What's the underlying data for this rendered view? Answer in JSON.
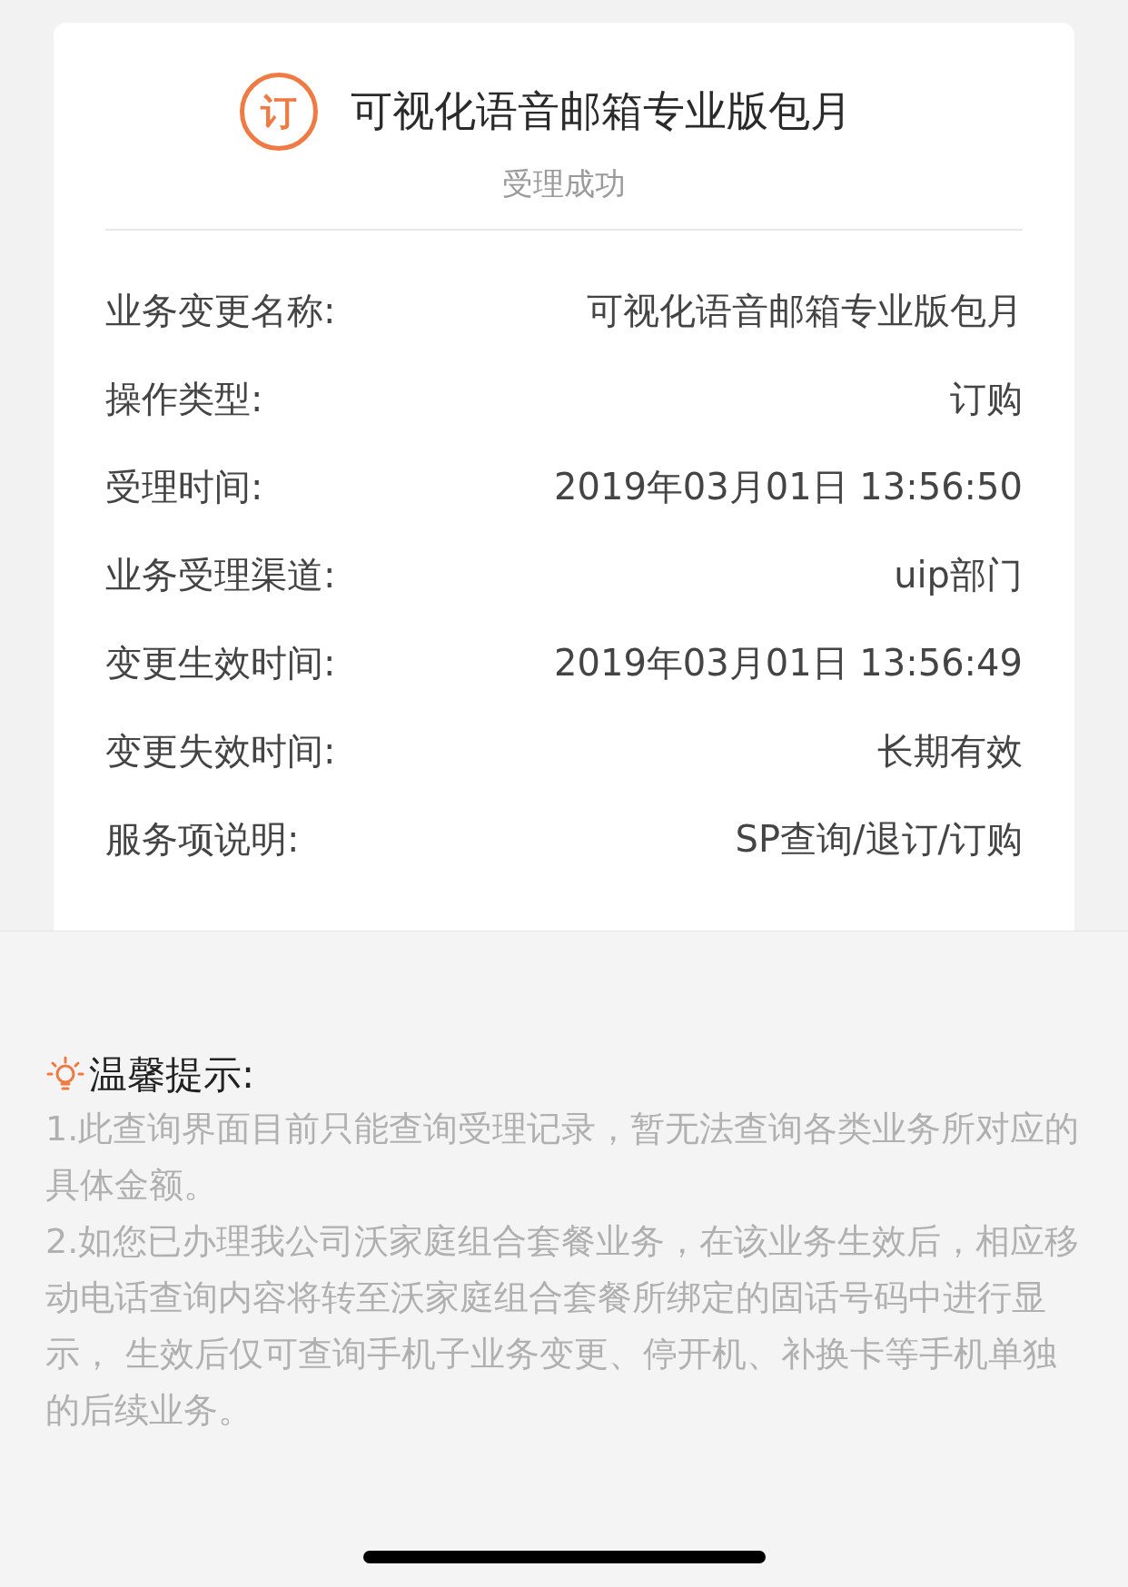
{
  "order_card": {
    "badge": "订",
    "title": "可视化语音邮箱专业版包月",
    "status": "受理成功",
    "rows": [
      {
        "label": "业务变更名称:",
        "value": "可视化语音邮箱专业版包月"
      },
      {
        "label": "操作类型:",
        "value": "订购"
      },
      {
        "label": "受理时间:",
        "value": "2019年03月01日 13:56:50"
      },
      {
        "label": "业务受理渠道:",
        "value": "uip部门"
      },
      {
        "label": "变更生效时间:",
        "value": "2019年03月01日 13:56:49"
      },
      {
        "label": "变更失效时间:",
        "value": "长期有效"
      },
      {
        "label": "服务项说明:",
        "value": "SP查询/退订/订购"
      }
    ]
  },
  "tips": {
    "heading": "温馨提示:",
    "paragraphs": [
      "1.此查询界面目前只能查询受理记录，暂无法查询各类业务所对应的具体金额。",
      "2.如您已办理我公司沃家庭组合套餐业务，在该业务生效后，相应移动电话查询内容将转至沃家庭组合套餐所绑定的固话号码中进行显示， 生效后仅可查询手机子业务变更、停开机、补换卡等手机单独的后续业务。"
    ]
  }
}
